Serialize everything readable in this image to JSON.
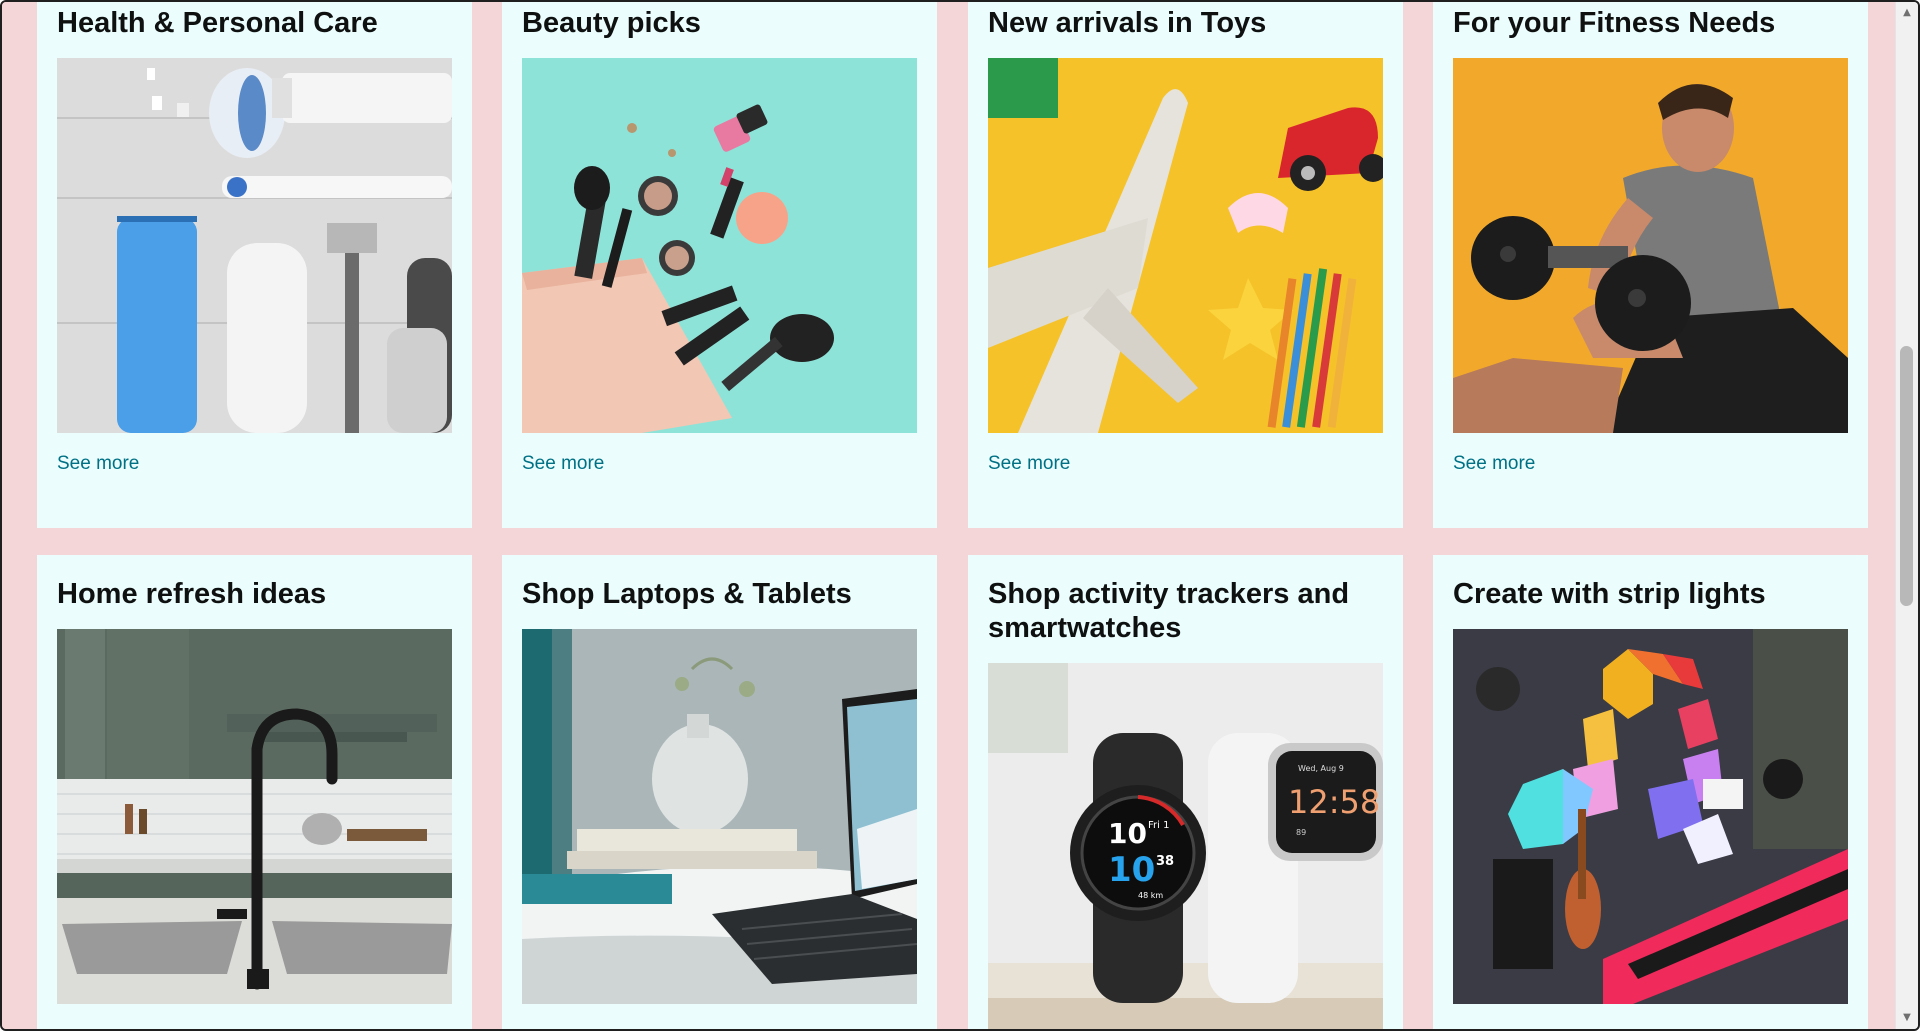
{
  "cards": [
    {
      "title": "Health & Personal Care",
      "link": "See more",
      "image": "health-personal-care-products-image"
    },
    {
      "title": "Beauty picks",
      "link": "See more",
      "image": "makeup-cosmetics-image"
    },
    {
      "title": "New arrivals in Toys",
      "link": "See more",
      "image": "toys-airplane-car-pencils-image"
    },
    {
      "title": "For your Fitness Needs",
      "link": "See more",
      "image": "man-lifting-dumbbell-image"
    },
    {
      "title": "Home refresh ideas",
      "image": "kitchen-faucet-sink-image"
    },
    {
      "title": "Shop Laptops & Tablets",
      "image": "laptop-desk-vase-image"
    },
    {
      "title": "Shop activity trackers and smartwatches",
      "image": "smartwatches-image"
    },
    {
      "title": "Create with strip lights",
      "image": "music-room-led-lights-image"
    }
  ],
  "watch": {
    "left_time_top": "10",
    "left_day": "Fri 1",
    "left_time_bottom": "10",
    "left_seconds": "38",
    "left_distance": "48 km",
    "right_date": "Wed, Aug 9",
    "right_time": "12:58",
    "right_stat": "89"
  },
  "colors": {
    "page_background": "#f5d6d8",
    "card_background": "#ebfdfd",
    "link": "#007185",
    "title": "#0f1111"
  },
  "scrollbar": {
    "up_icon": "scroll-up-arrow-icon",
    "down_icon": "scroll-down-arrow-icon"
  }
}
